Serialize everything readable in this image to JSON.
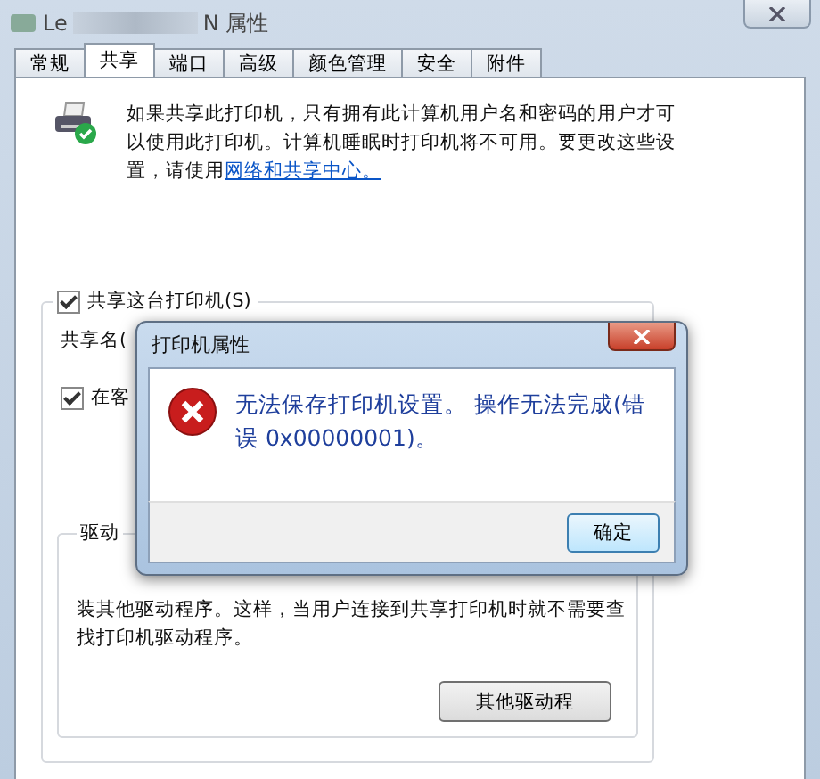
{
  "window": {
    "title_start": "Le",
    "title_end": "N 属性"
  },
  "tabs": [
    {
      "label": "常规",
      "selected": false
    },
    {
      "label": "共享",
      "selected": true
    },
    {
      "label": "端口",
      "selected": false
    },
    {
      "label": "高级",
      "selected": false
    },
    {
      "label": "颜色管理",
      "selected": false
    },
    {
      "label": "安全",
      "selected": false
    },
    {
      "label": "附件",
      "selected": false
    }
  ],
  "intro": {
    "text": "如果共享此打印机，只有拥有此计算机用户名和密码的用户才可以使用此打印机。计算机睡眠时打印机将不可用。要更改这些设置，请使用",
    "link": "网络和共享中心。"
  },
  "share_checkbox": {
    "label": "共享这台打印机(S)",
    "checked": true
  },
  "share_name_label": "共享名(",
  "render_checkbox": {
    "label": "在客",
    "checked": true
  },
  "drivers": {
    "title": "驱动",
    "text": "装其他驱动程序。这样，当用户连接到共享打印机时就不需要查找打印机驱动程序。",
    "button": "其他驱动程"
  },
  "dialog": {
    "title": "打印机属性",
    "message": "无法保存打印机设置。 操作无法完成(错误 0x00000001)。",
    "ok": "确定"
  }
}
